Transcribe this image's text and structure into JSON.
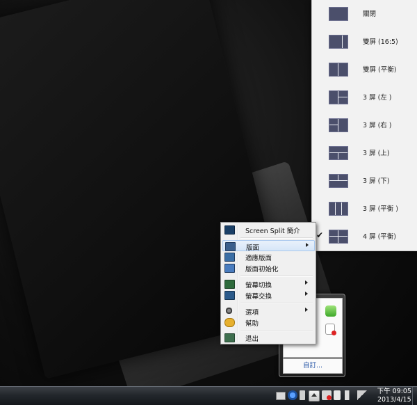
{
  "layout_menu": {
    "items": [
      {
        "label": "關閉",
        "checked": false,
        "icon": "layout-full-icon"
      },
      {
        "label": "雙屏 (16:5)",
        "checked": false,
        "icon": "layout-split-16-5-icon"
      },
      {
        "label": "雙屏 (平衡)",
        "checked": false,
        "icon": "layout-split-even-icon"
      },
      {
        "label": "3 屏 (左 )",
        "checked": false,
        "icon": "layout-3-left-icon"
      },
      {
        "label": "3 屏 (右 )",
        "checked": false,
        "icon": "layout-3-right-icon"
      },
      {
        "label": "3 屏 (上)",
        "checked": false,
        "icon": "layout-3-top-icon"
      },
      {
        "label": "3 屏 (下)",
        "checked": false,
        "icon": "layout-3-bottom-icon"
      },
      {
        "label": "3 屏 (平衡 )",
        "checked": false,
        "icon": "layout-3-even-icon"
      },
      {
        "label": "4 屏 (平衡)",
        "checked": true,
        "icon": "layout-4-even-icon"
      }
    ],
    "check_glyph": "✔"
  },
  "context_menu": {
    "items": [
      {
        "label": "Screen Split 簡介",
        "icon": "monitor-icon",
        "submenu": false
      },
      {
        "label": "版面",
        "icon": "layout-icon",
        "submenu": true,
        "highlighted": true
      },
      {
        "label": "適應版面",
        "icon": "fit-layout-icon",
        "submenu": false
      },
      {
        "label": "版面初始化",
        "icon": "reset-icon",
        "submenu": false
      },
      {
        "label": "螢幕切換",
        "icon": "switch-screen-icon",
        "submenu": true
      },
      {
        "label": "螢幕交換",
        "icon": "swap-screen-icon",
        "submenu": true
      },
      {
        "label": "選項",
        "icon": "gear-icon",
        "submenu": true
      },
      {
        "label": "幫助",
        "icon": "help-icon",
        "submenu": false
      },
      {
        "label": "退出",
        "icon": "exit-icon",
        "submenu": false
      }
    ]
  },
  "tray_popup": {
    "customize_label": "自訂..."
  },
  "taskbar": {
    "time": "下午 09:05",
    "date": "2013/4/15"
  },
  "colors": {
    "thumb_fill": "#4b4f6b",
    "menu_bg": "#f0f0f0",
    "highlight": "#d6e6f8",
    "link": "#1e4fa3"
  }
}
